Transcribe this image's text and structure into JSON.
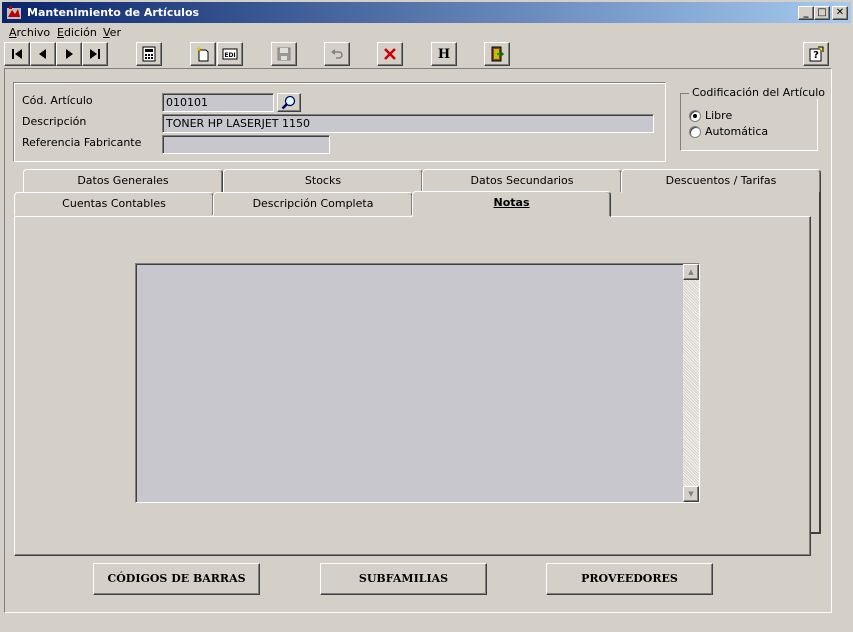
{
  "window": {
    "title": "Mantenimiento de Artículos",
    "controls": {
      "minimize": "_",
      "maximize": "□",
      "close": "✕"
    }
  },
  "menu": {
    "items": [
      {
        "label": "Archivo",
        "accel": "A",
        "rest": "rchivo"
      },
      {
        "label": "Edición",
        "accel": "E",
        "rest": "dición"
      },
      {
        "label": "Ver",
        "accel": "V",
        "rest": "er"
      }
    ]
  },
  "toolbar": {
    "buttons": [
      "first-record-icon",
      "previous-record-icon",
      "next-record-icon",
      "last-record-icon",
      "calculator-icon",
      "new-record-icon",
      "edit-record-icon",
      "save-icon",
      "undo-icon",
      "delete-icon",
      "help-h-icon",
      "exit-door-icon",
      "help-question-icon"
    ],
    "help_h_label": "H",
    "edit_label": "EDI"
  },
  "article": {
    "code_label": "Cód. Artículo",
    "code_value": "010101",
    "description_label": "Descripción",
    "description_value": "TONER HP LASERJET 1150",
    "manufacturer_ref_label": "Referencia Fabricante",
    "manufacturer_ref_value": ""
  },
  "codification": {
    "title": "Codificación del Artículo",
    "options": [
      {
        "label": "Libre",
        "selected": true
      },
      {
        "label": "Automática",
        "selected": false
      }
    ]
  },
  "tabs": {
    "row1": [
      "Datos Generales",
      "Stocks",
      "Datos Secundarios",
      "Descuentos / Tarifas"
    ],
    "row2": [
      "Cuentas Contables",
      "Descripción Completa",
      "Notas"
    ],
    "active": "Notas"
  },
  "notes": {
    "value": ""
  },
  "bottom_buttons": {
    "barcodes": "CÓDIGOS DE BARRAS",
    "subfamilies": "SUBFAMILIAS",
    "suppliers": "PROVEEDORES"
  },
  "colors": {
    "titlebar_start": "#0a246a",
    "titlebar_end": "#a6caf0",
    "face": "#d4d0c8",
    "field_bg": "#c8c7cd",
    "delete_red": "#cc0000"
  }
}
